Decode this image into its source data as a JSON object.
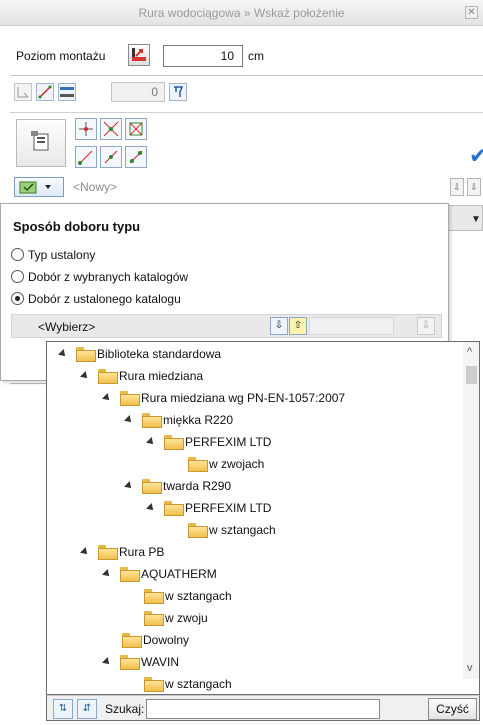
{
  "window": {
    "title": "Rura wodociągowa » Wskaż położenie"
  },
  "poziom": {
    "label": "Poziom montażu",
    "value": "10",
    "unit": "cm"
  },
  "tools_row": {
    "number_value": "0"
  },
  "nowy": {
    "text": "<Nowy>"
  },
  "sposob": {
    "heading": "Sposób doboru typu",
    "options": [
      {
        "label": "Typ ustalony",
        "selected": false
      },
      {
        "label": "Dobór z wybranych katalogów",
        "selected": false
      },
      {
        "label": "Dobór z ustalonego katalogu",
        "selected": true
      }
    ],
    "wybierz": "<Wybierz>"
  },
  "tree": {
    "items": [
      {
        "label": "Biblioteka standardowa",
        "level": 0,
        "expanded": true
      },
      {
        "label": "Rura miedziana",
        "level": 1,
        "expanded": true
      },
      {
        "label": "Rura miedziana wg PN-EN-1057:2007",
        "level": 2,
        "expanded": true
      },
      {
        "label": "miękka R220",
        "level": 3,
        "expanded": true
      },
      {
        "label": "PERFEXIM LTD",
        "level": 4,
        "expanded": true
      },
      {
        "label": "w zwojach",
        "level": 5,
        "expanded": false
      },
      {
        "label": "twarda R290",
        "level": 3,
        "expanded": true
      },
      {
        "label": "PERFEXIM LTD",
        "level": 4,
        "expanded": true
      },
      {
        "label": "w sztangach",
        "level": 5,
        "expanded": false
      },
      {
        "label": "Rura PB",
        "level": 1,
        "expanded": true
      },
      {
        "label": "AQUATHERM",
        "level": 2,
        "expanded": true
      },
      {
        "label": "w sztangach",
        "level": 3,
        "expanded": false
      },
      {
        "label": "w zwoju",
        "level": 3,
        "expanded": false
      },
      {
        "label": "Dowolny",
        "level": 2,
        "expanded": false
      },
      {
        "label": "WAVIN",
        "level": 2,
        "expanded": true
      },
      {
        "label": "w sztangach",
        "level": 3,
        "expanded": false
      }
    ]
  },
  "search": {
    "label": "Szukaj:",
    "value": "",
    "clear_label": "Czyść"
  },
  "colors": {
    "accent": "#2d6fc9",
    "folder": "#f2c04c"
  }
}
